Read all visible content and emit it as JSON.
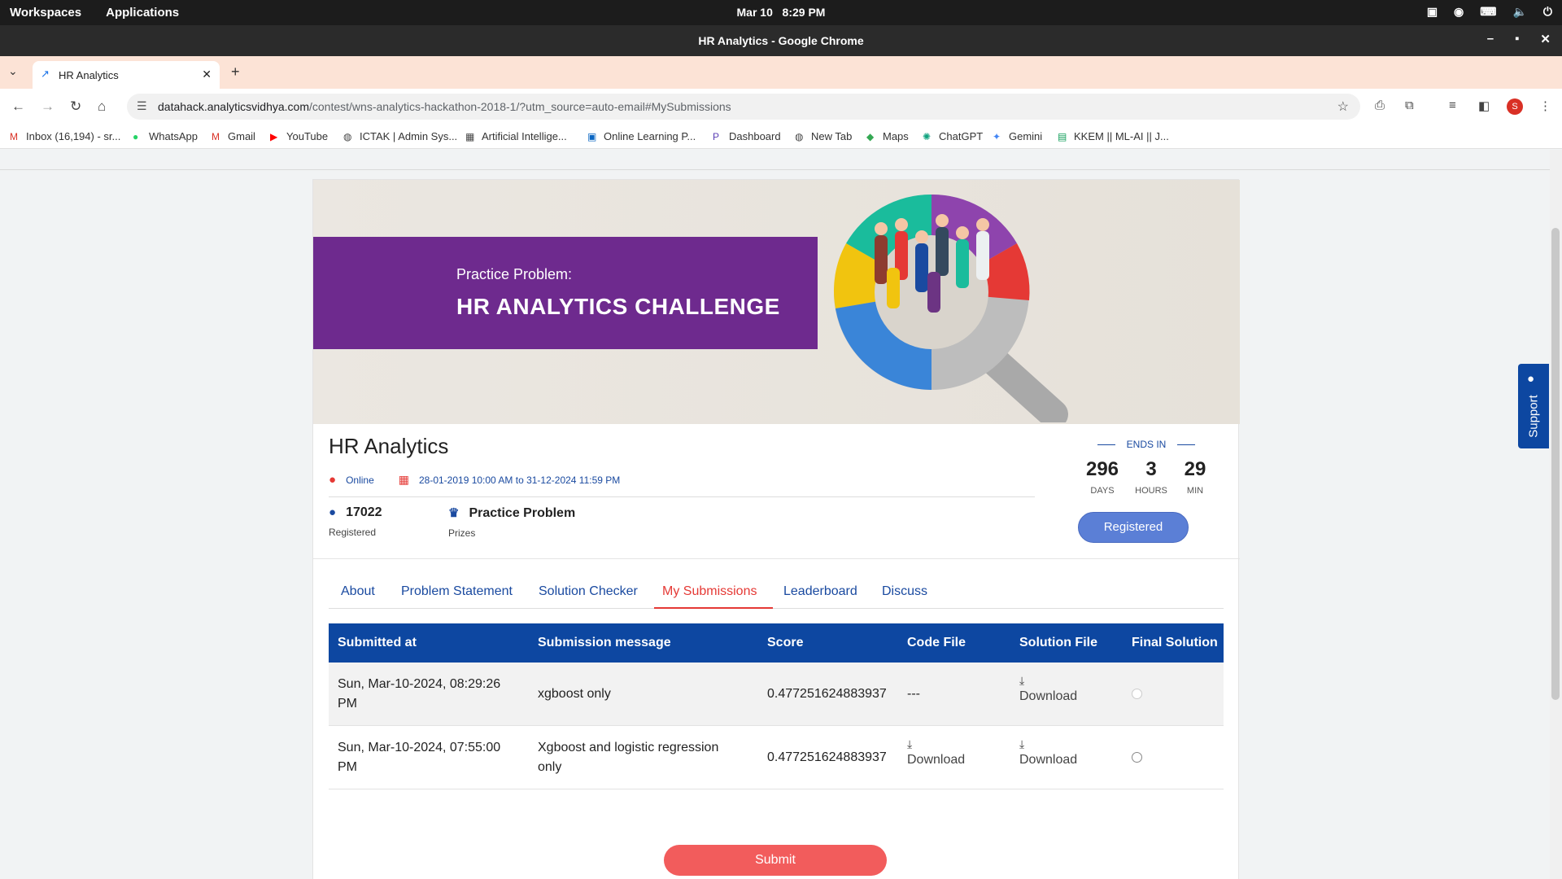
{
  "os": {
    "workspaces": "Workspaces",
    "applications": "Applications",
    "date": "Mar 10",
    "time": "8:29 PM"
  },
  "window": {
    "title": "HR Analytics - Google Chrome"
  },
  "browser": {
    "tab_title": "HR Analytics",
    "url_host": "datahack.analyticsvidhya.com",
    "url_path": "/contest/wns-analytics-hackathon-2018-1/?utm_source=auto-email#MySubmissions",
    "profile_initial": "S"
  },
  "bookmarks": [
    {
      "label": "Inbox (16,194) - sr...",
      "icon": "gmail-icon"
    },
    {
      "label": "WhatsApp",
      "icon": "whatsapp-icon"
    },
    {
      "label": "Gmail",
      "icon": "gmail-icon"
    },
    {
      "label": "YouTube",
      "icon": "youtube-icon"
    },
    {
      "label": "ICTAK | Admin Sys...",
      "icon": "globe-icon"
    },
    {
      "label": "Artificial Intellige...",
      "icon": "site-icon"
    },
    {
      "label": "Online Learning P...",
      "icon": "linkedin-icon"
    },
    {
      "label": "Dashboard",
      "icon": "site-icon"
    },
    {
      "label": "New Tab",
      "icon": "globe-icon"
    },
    {
      "label": "Maps",
      "icon": "maps-icon"
    },
    {
      "label": "ChatGPT",
      "icon": "chatgpt-icon"
    },
    {
      "label": "Gemini",
      "icon": "gemini-icon"
    },
    {
      "label": "KKEM || ML-AI || J...",
      "icon": "sheets-icon"
    }
  ],
  "banner": {
    "subtitle": "Practice Problem:",
    "title": "HR ANALYTICS CHALLENGE"
  },
  "contest": {
    "title": "HR Analytics",
    "mode": "Online",
    "dates": "28-01-2019 10:00 AM to 31-12-2024 11:59 PM",
    "registered_count": "17022",
    "registered_label": "Registered",
    "prize_value": "Practice Problem",
    "prize_label": "Prizes",
    "ends_in_label": "ENDS IN",
    "countdown": {
      "days": "296",
      "days_label": "DAYS",
      "hours": "3",
      "hours_label": "HOURS",
      "min": "29",
      "min_label": "MIN"
    },
    "register_button": "Registered"
  },
  "tabs": [
    {
      "label": "About"
    },
    {
      "label": "Problem Statement"
    },
    {
      "label": "Solution Checker"
    },
    {
      "label": "My Submissions",
      "active": true
    },
    {
      "label": "Leaderboard"
    },
    {
      "label": "Discuss"
    }
  ],
  "table": {
    "headers": [
      "Submitted at",
      "Submission message",
      "Score",
      "Code File",
      "Solution File",
      "Final Solution"
    ],
    "rows": [
      {
        "submitted_line1": "Sun, Mar-10-2024, 08:29:26",
        "submitted_line2": "PM",
        "message_line1": "xgboost only",
        "message_line2": "",
        "score": "0.477251624883937",
        "code_file": "---",
        "solution_file": "Download"
      },
      {
        "submitted_line1": "Sun, Mar-10-2024, 07:55:00",
        "submitted_line2": "PM",
        "message_line1": "Xgboost and logistic regression",
        "message_line2": "only",
        "score": "0.477251624883937",
        "code_file": "Download",
        "solution_file": "Download"
      }
    ]
  },
  "submit_button": "Submit",
  "support": "Support",
  "colors": {
    "brand_blue": "#0d47a1",
    "accent_red": "#e53935",
    "submit_red": "#f25c5c",
    "banner_purple": "#6e2a8e"
  }
}
